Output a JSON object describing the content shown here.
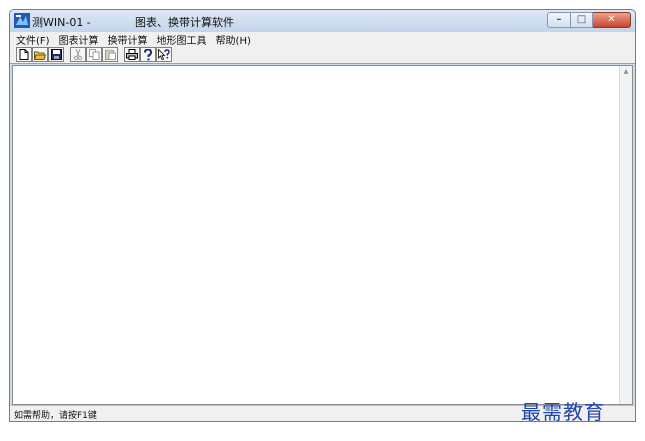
{
  "window": {
    "title": "测WIN-01    -",
    "subtitle": "图表、换带计算软件"
  },
  "controls": {
    "minimize_glyph": "–",
    "maximize_glyph": "□",
    "close_glyph": "✕"
  },
  "menu": {
    "items": [
      "文件(F)",
      "图表计算",
      "换带计算",
      "地形图工具",
      "帮助(H)"
    ]
  },
  "toolbar": {
    "buttons": [
      "new-file",
      "open-folder",
      "save",
      "cut",
      "copy",
      "paste",
      "print",
      "about",
      "context-help"
    ]
  },
  "status": {
    "text": "如需帮助，请按F1键"
  },
  "watermark": {
    "text": "最需教育"
  },
  "colors": {
    "accent": "#1f43a8",
    "close": "#c8452e"
  }
}
